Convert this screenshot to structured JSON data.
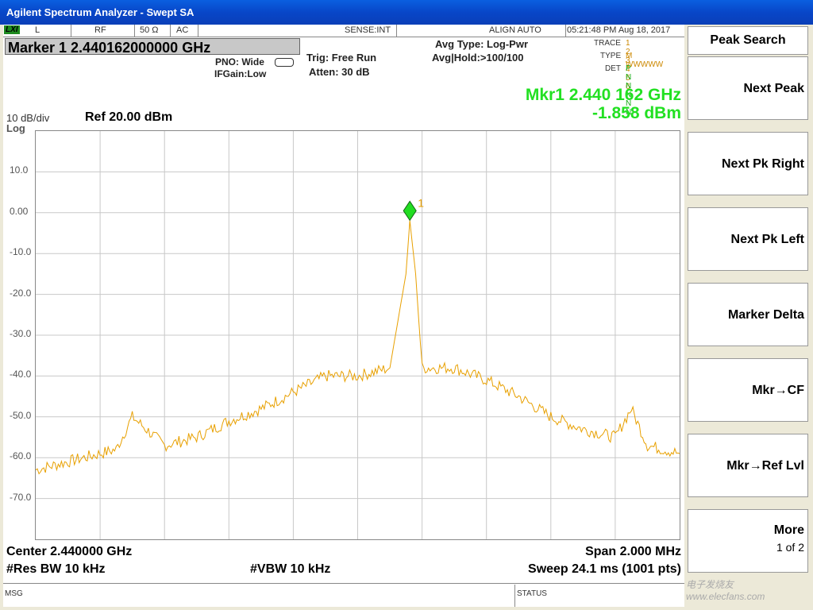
{
  "window": {
    "title": "Agilent Spectrum Analyzer - Swept SA"
  },
  "status": {
    "lxi": "LXI",
    "input": "L",
    "rf": "RF",
    "impedance": "50 Ω",
    "coupling": "AC",
    "sense": "SENSE:INT",
    "align": "ALIGN AUTO",
    "datetime": "05:21:48 PM Aug 18, 2017"
  },
  "marker_box": "Marker 1 2.440162000000 GHz",
  "settings": {
    "pno": "PNO: Wide",
    "ifgain": "IFGain:Low",
    "trig": "Trig: Free Run",
    "atten": "Atten: 30 dB",
    "avg_type": "Avg Type: Log-Pwr",
    "avg_hold": "Avg|Hold:>100/100"
  },
  "trace_table": {
    "trace_label": "TRACE",
    "type_label": "TYPE",
    "det_label": "DET",
    "trace_nums": "1 2 3 4 5 6",
    "type_vals": "M WWWWW",
    "det_vals": "P N N N N N"
  },
  "marker_readout": {
    "freq": "Mkr1 2.440 162 GHz",
    "level": "-1.858 dBm"
  },
  "scale": {
    "div": "10 dB/div",
    "log": "Log",
    "ref": "Ref 20.00 dBm"
  },
  "chart_data": {
    "type": "line",
    "xlabel": "",
    "ylabel": "",
    "x_range_ghz": [
      2.439,
      2.441
    ],
    "ylim": [
      -80,
      20
    ],
    "y_ticks": [
      "10.0",
      "0.00",
      "-10.0",
      "-20.0",
      "-30.0",
      "-40.0",
      "-50.0",
      "-60.0",
      "-70.0"
    ],
    "grid": true,
    "series": [
      {
        "color": "#e8a000",
        "x": [
          2.439,
          2.4391,
          2.4392,
          2.43925,
          2.4393,
          2.4394,
          2.4395,
          2.4396,
          2.4397,
          2.4398,
          2.43985,
          2.4399,
          2.43995,
          2.44,
          2.44005,
          2.4401,
          2.44015,
          2.440162,
          2.44018,
          2.4402,
          2.44025,
          2.4403,
          2.4404,
          2.4405,
          2.4406,
          2.4407,
          2.4408,
          2.44085,
          2.4409,
          2.441
        ],
        "y": [
          -63,
          -61,
          -59,
          -58,
          -50,
          -57,
          -55,
          -51,
          -48,
          -44,
          -42,
          -40,
          -40,
          -40,
          -39,
          -38,
          -15,
          -1.9,
          -15,
          -38,
          -38,
          -38,
          -41,
          -45,
          -50,
          -53,
          -55,
          -48,
          -57,
          -59
        ]
      }
    ],
    "marker": {
      "label": "1",
      "x": 2.440162,
      "y": -1.858
    }
  },
  "footer": {
    "center": "Center 2.440000 GHz",
    "span": "Span 2.000 MHz",
    "rbw": "#Res BW 10 kHz",
    "vbw": "#VBW 10 kHz",
    "sweep": "Sweep  24.1 ms (1001 pts)",
    "msg": "MSG",
    "status": "STATUS"
  },
  "softkeys": {
    "title": "Peak Search",
    "items": [
      "Next Peak",
      "Next Pk Right",
      "Next Pk Left",
      "Marker Delta",
      "Mkr→CF",
      "Mkr→Ref Lvl"
    ],
    "more": "More",
    "page": "1 of 2"
  },
  "watermark": "电子发烧友 www.elecfans.com",
  "colors": {
    "trace": "#e8a000",
    "marker": "#22dd22",
    "grid": "#c8c8c8"
  }
}
